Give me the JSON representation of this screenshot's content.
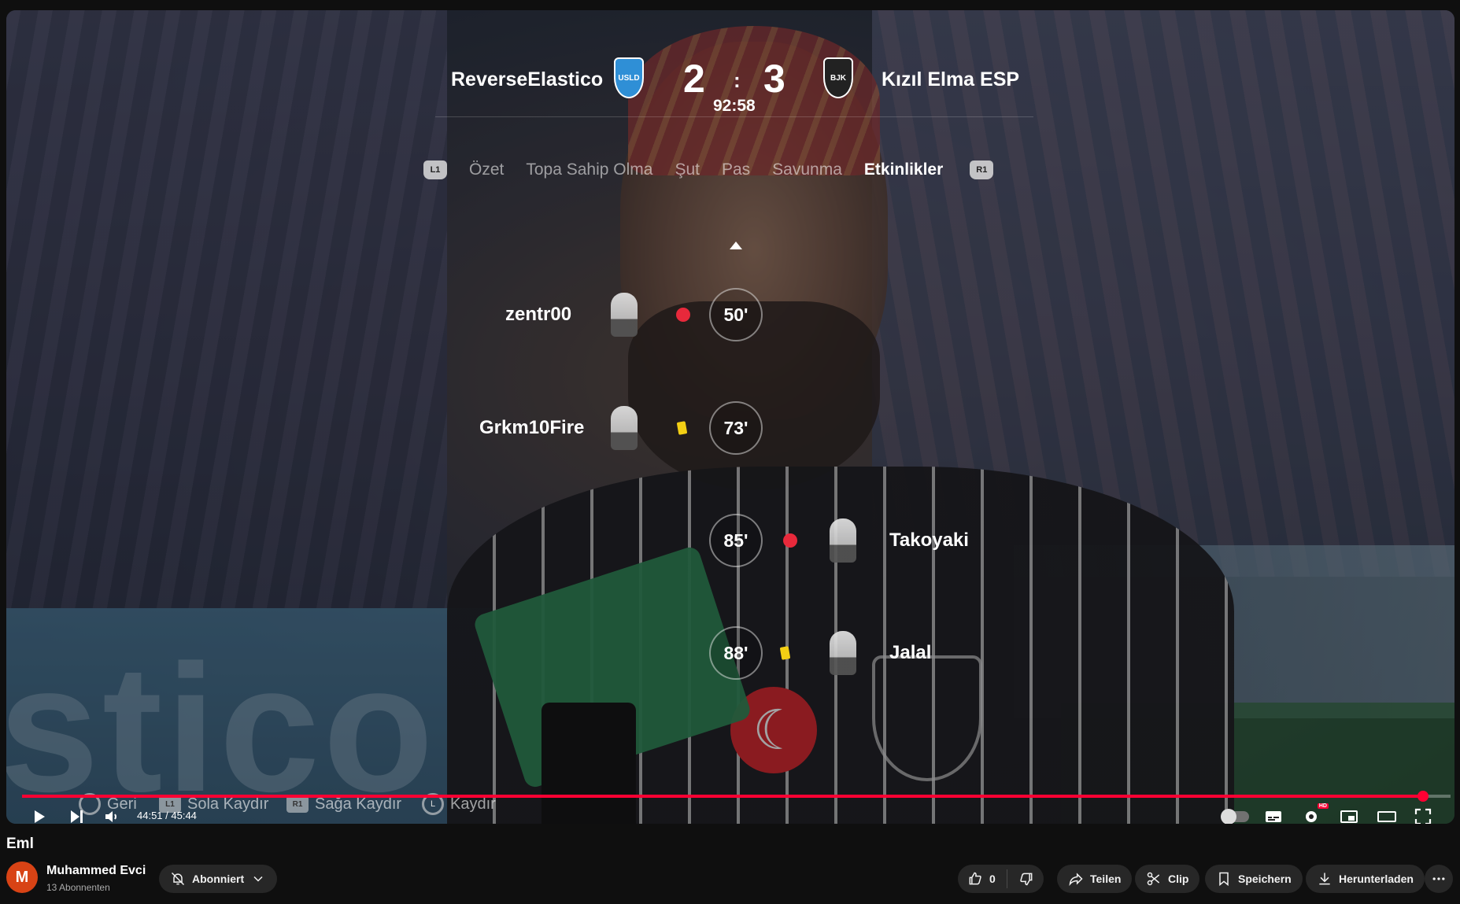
{
  "scoreboard": {
    "home_team": "ReverseElastico",
    "away_team": "Kızıl Elma ESP",
    "home_crest_text": "USLD",
    "away_crest_text": "BJK",
    "home_goals": "2",
    "separator": ":",
    "away_goals": "3",
    "clock": "92:58"
  },
  "tabs": {
    "left_trigger": "L1",
    "right_trigger": "R1",
    "items": [
      "Özet",
      "Topa Sahip Olma",
      "Şut",
      "Pas",
      "Savunma",
      "Etkinlikler"
    ],
    "active": "Etkinlikler"
  },
  "events": [
    {
      "side": "home",
      "player": "zentr00",
      "minute": "50'",
      "type": "red-card"
    },
    {
      "side": "home",
      "player": "Grkm10Fire",
      "minute": "73'",
      "type": "yellow-card"
    },
    {
      "side": "away",
      "player": "Takoyaki",
      "minute": "85'",
      "type": "red-card"
    },
    {
      "side": "away",
      "player": "Jalal",
      "minute": "88'",
      "type": "yellow-card"
    }
  ],
  "background_text": "stico",
  "game_hints": {
    "back_label": "Geri",
    "left_btn": "L1",
    "left_label": "Sola Kaydır",
    "right_btn": "R1",
    "right_label": "Sağa Kaydır",
    "stick_btn": "L",
    "scroll_label": "Kaydır"
  },
  "player_controls": {
    "time_current": "44:51",
    "time_total": "45:44",
    "time_display": "44:51 / 45:44",
    "progress_fraction": 0.9806,
    "hd_badge": "HD",
    "accent_color": "#ff0033"
  },
  "video": {
    "title": "Eml",
    "channel_initial": "M",
    "channel_name": "Muhammed Evci",
    "subscribers": "13 Abonnenten",
    "subscribe_label": "Abonniert",
    "like_count": "0",
    "share_label": "Teilen",
    "clip_label": "Clip",
    "save_label": "Speichern",
    "download_label": "Herunterladen"
  }
}
